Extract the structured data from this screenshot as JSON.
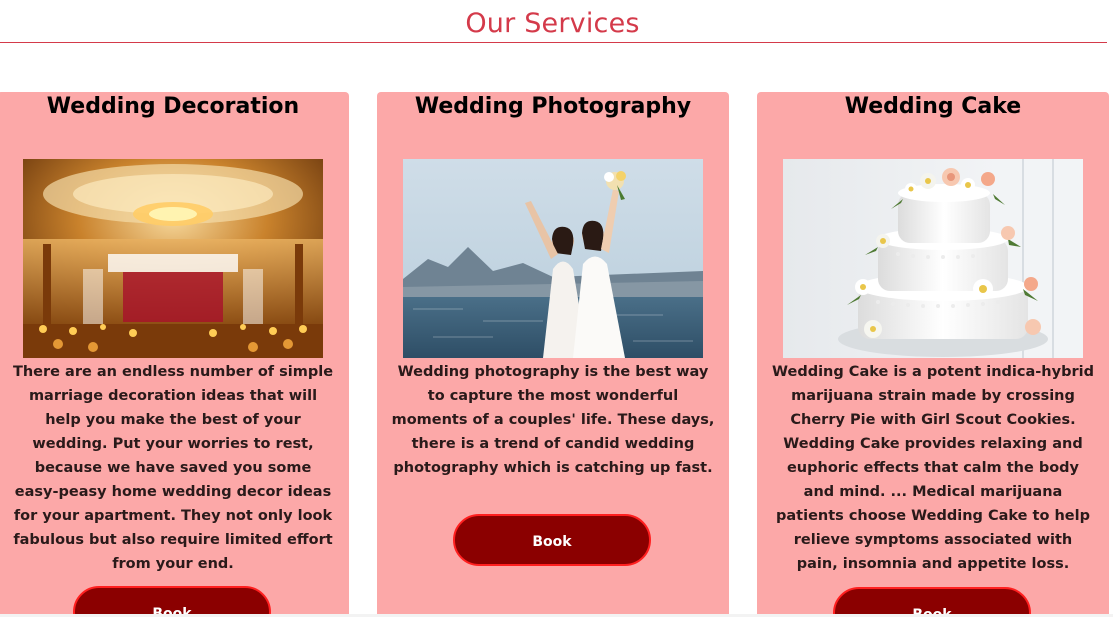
{
  "section": {
    "title": "Our Services"
  },
  "cards": [
    {
      "title": "Wedding Decoration",
      "image_alt": "wedding-decoration-photo",
      "description": "There are an endless number of simple marriage decoration ideas that will help you make the best of your wedding. Put your worries to rest, because we have saved you some easy-peasy home wedding decor ideas for your apartment. They not only look fabulous but also require limited effort from your end.",
      "button_label": "Book"
    },
    {
      "title": "Wedding Photography",
      "image_alt": "wedding-photography-photo",
      "description": "Wedding photography is the best way to capture the most wonderful moments of a couples' life. These days, there is a trend of candid wedding photography which is catching up fast.",
      "button_label": "Book"
    },
    {
      "title": "Wedding Cake",
      "image_alt": "wedding-cake-photo",
      "description": "Wedding Cake is a potent indica-hybrid marijuana strain made by crossing Cherry Pie with Girl Scout Cookies. Wedding Cake provides relaxing and euphoric effects that calm the body and mind. ... Medical marijuana patients choose Wedding Cake to help relieve symptoms associated with pain, insomnia and appetite loss.",
      "button_label": "Book"
    }
  ],
  "colors": {
    "accent": "#d43a4a",
    "card_background": "#fca8a8",
    "button_background": "#8b0000",
    "button_border": "#ff2020"
  }
}
